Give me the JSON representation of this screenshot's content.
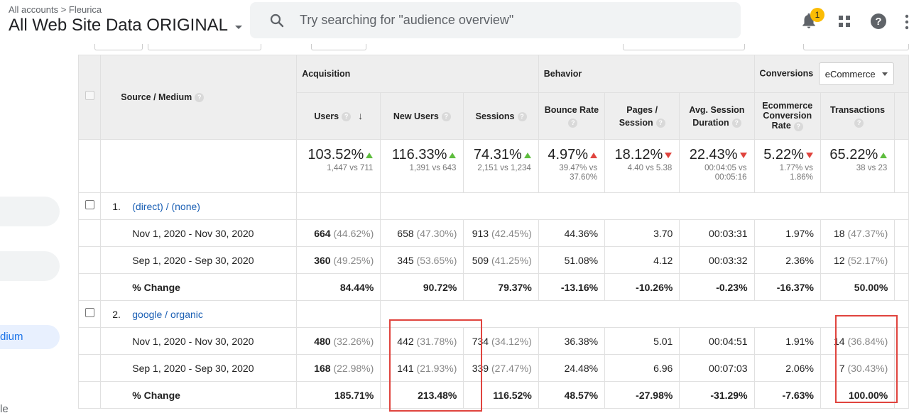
{
  "header": {
    "breadcrumb": "All accounts > Fleurica",
    "account": "All Web Site Data ORIGINAL",
    "search_placeholder": "Try searching for \"audience overview\"",
    "notification_count": "1"
  },
  "sidebar": {
    "active_fragment": "dium",
    "bottom_fragment": "le"
  },
  "table": {
    "groups": {
      "acquisition": "Acquisition",
      "behavior": "Behavior",
      "conversions": "Conversions",
      "conversions_select": "eCommerce"
    },
    "headers": {
      "source_medium": "Source / Medium",
      "users": "Users",
      "new_users": "New Users",
      "sessions": "Sessions",
      "bounce_rate": "Bounce Rate",
      "pages_session_1": "Pages /",
      "pages_session_2": "Session",
      "avg_duration_1": "Avg. Session",
      "avg_duration_2": "Duration",
      "ecr_1": "Ecommerce",
      "ecr_2": "Conversion",
      "ecr_3": "Rate",
      "transactions": "Transactions"
    },
    "summary": {
      "users": {
        "value": "103.52%",
        "sub": "1,447 vs 711",
        "dir": "up-good"
      },
      "new_users": {
        "value": "116.33%",
        "sub": "1,391 vs 643",
        "dir": "up-good"
      },
      "sessions": {
        "value": "74.31%",
        "sub": "2,151 vs 1,234",
        "dir": "up-good"
      },
      "bounce_rate": {
        "value": "4.97%",
        "sub1": "39.47% vs",
        "sub2": "37.60%",
        "dir": "up-bad"
      },
      "pages_session": {
        "value": "18.12%",
        "sub": "4.40 vs 5.38",
        "dir": "down-bad"
      },
      "avg_duration": {
        "value": "22.43%",
        "sub1": "00:04:05 vs",
        "sub2": "00:05:16",
        "dir": "down-bad"
      },
      "ecr": {
        "value": "5.22%",
        "sub1": "1.77% vs",
        "sub2": "1.86%",
        "dir": "down-bad"
      },
      "transactions": {
        "value": "65.22%",
        "sub": "38 vs 23",
        "dir": "up-good"
      }
    },
    "groups_rows": [
      {
        "index": "1.",
        "source": "(direct) / (none)",
        "rows": [
          {
            "label": "Nov 1, 2020 - Nov 30, 2020",
            "users": "664",
            "users_pct": "(44.62%)",
            "new_users": "658",
            "new_users_pct": "(47.30%)",
            "sessions": "913",
            "sessions_pct": "(42.45%)",
            "bounce": "44.36%",
            "pages": "3.70",
            "duration": "00:03:31",
            "ecr": "1.97%",
            "transactions": "18",
            "transactions_pct": "(47.37%)"
          },
          {
            "label": "Sep 1, 2020 - Sep 30, 2020",
            "users": "360",
            "users_pct": "(49.25%)",
            "new_users": "345",
            "new_users_pct": "(53.65%)",
            "sessions": "509",
            "sessions_pct": "(41.25%)",
            "bounce": "51.08%",
            "pages": "4.12",
            "duration": "00:03:32",
            "ecr": "2.36%",
            "transactions": "12",
            "transactions_pct": "(52.17%)"
          },
          {
            "label": "% Change",
            "users": "84.44%",
            "new_users": "90.72%",
            "sessions": "79.37%",
            "bounce": "-13.16%",
            "pages": "-10.26%",
            "duration": "-0.23%",
            "ecr": "-16.37%",
            "transactions": "50.00%"
          }
        ]
      },
      {
        "index": "2.",
        "source": "google / organic",
        "rows": [
          {
            "label": "Nov 1, 2020 - Nov 30, 2020",
            "users": "480",
            "users_pct": "(32.26%)",
            "new_users": "442",
            "new_users_pct": "(31.78%)",
            "sessions": "734",
            "sessions_pct": "(34.12%)",
            "bounce": "36.38%",
            "pages": "5.01",
            "duration": "00:04:51",
            "ecr": "1.91%",
            "transactions": "14",
            "transactions_pct": "(36.84%)"
          },
          {
            "label": "Sep 1, 2020 - Sep 30, 2020",
            "users": "168",
            "users_pct": "(22.98%)",
            "new_users": "141",
            "new_users_pct": "(21.93%)",
            "sessions": "339",
            "sessions_pct": "(27.47%)",
            "bounce": "24.48%",
            "pages": "6.96",
            "duration": "00:07:03",
            "ecr": "2.06%",
            "transactions": "7",
            "transactions_pct": "(30.43%)"
          },
          {
            "label": "% Change",
            "users": "185.71%",
            "new_users": "213.48%",
            "sessions": "116.52%",
            "bounce": "48.57%",
            "pages": "-27.98%",
            "duration": "-31.29%",
            "ecr": "-7.63%",
            "transactions": "100.00%"
          }
        ]
      }
    ]
  },
  "colors": {
    "up_good": "#5ebd3e",
    "down_bad": "#e0443e",
    "link": "#1a5fb4",
    "highlight_box": "#e0443e"
  }
}
